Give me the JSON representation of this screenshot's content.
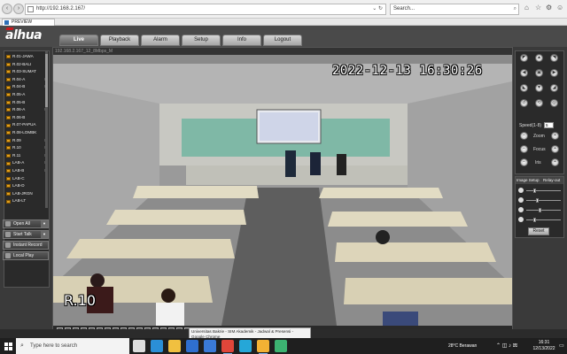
{
  "browser": {
    "url": "http://192.168.2.167/",
    "search_placeholder": "Search...",
    "tab_title": "PREVIEW"
  },
  "app": {
    "logo": "alhua",
    "tabs": [
      {
        "label": "Live",
        "active": true
      },
      {
        "label": "Playback",
        "active": false
      },
      {
        "label": "Alarm",
        "active": false
      },
      {
        "label": "Setup",
        "active": false
      },
      {
        "label": "Info",
        "active": false
      },
      {
        "label": "Logout",
        "active": false
      }
    ]
  },
  "camera_list": [
    {
      "name": "R.01-JAWA",
      "flag": ""
    },
    {
      "name": "R.02-BALI",
      "flag": ""
    },
    {
      "name": "R.03-SUMAT",
      "flag": ""
    },
    {
      "name": "R.04-A",
      "flag": "M"
    },
    {
      "name": "R.04-B",
      "flag": "M"
    },
    {
      "name": "R.05-A",
      "flag": ""
    },
    {
      "name": "R.05-B",
      "flag": ""
    },
    {
      "name": "R.06-A",
      "flag": "M"
    },
    {
      "name": "R.06-B",
      "flag": ""
    },
    {
      "name": "R.07-PAPUA",
      "flag": ""
    },
    {
      "name": "R.08-LOMBK",
      "flag": ""
    },
    {
      "name": "R.09",
      "flag": "M"
    },
    {
      "name": "R.10",
      "flag": "M"
    },
    {
      "name": "R.11",
      "flag": "M"
    },
    {
      "name": "LAB-A",
      "flag": "M"
    },
    {
      "name": "LAB-B",
      "flag": "M"
    },
    {
      "name": "LAB-C",
      "flag": ""
    },
    {
      "name": "LAB-D",
      "flag": ""
    },
    {
      "name": "LAB-JRGN",
      "flag": ""
    },
    {
      "name": "LAB-LT",
      "flag": ""
    }
  ],
  "left_buttons": {
    "open_all": "Open All",
    "start_talk": "Start Talk",
    "instant_record": "Instant Record",
    "local_play": "Local Play"
  },
  "video": {
    "info_bar": "192.168.2.167_12_8Mbps_M",
    "timestamp": "2022-12-13 16:30:26",
    "camera_name": "R.10"
  },
  "ptz": {
    "speed_label": "Speed(1-8)",
    "speed_value": "5",
    "zoom_label": "Zoom",
    "focus_label": "Focus",
    "iris_label": "Iris"
  },
  "image_setup": {
    "tab_image": "Image Setup",
    "tab_relay": "Relay-out",
    "sliders": [
      0.22,
      0.3,
      0.4,
      0.22
    ],
    "reset_label": "Reset"
  },
  "status_bar": "Reserved",
  "tooltip": {
    "line1": "Universitas Bakrie - SIM Akademik - Jadwal & Presensi -",
    "line2": "Google Chrome"
  },
  "taskbar": {
    "search_placeholder": "Type here to search",
    "weather": "28°C  Berawan",
    "time": "16:31",
    "date": "12/13/2022",
    "colors": {
      "taskview": "#dddddd",
      "edge": "#2b8fd6",
      "explorer": "#f0c040",
      "store": "#2f6fd0",
      "mail": "#3a7ad8",
      "chrome": "#e0463a",
      "app7": "#25a7d8",
      "app8": "#f2b134",
      "app9": "#3cb371"
    }
  }
}
